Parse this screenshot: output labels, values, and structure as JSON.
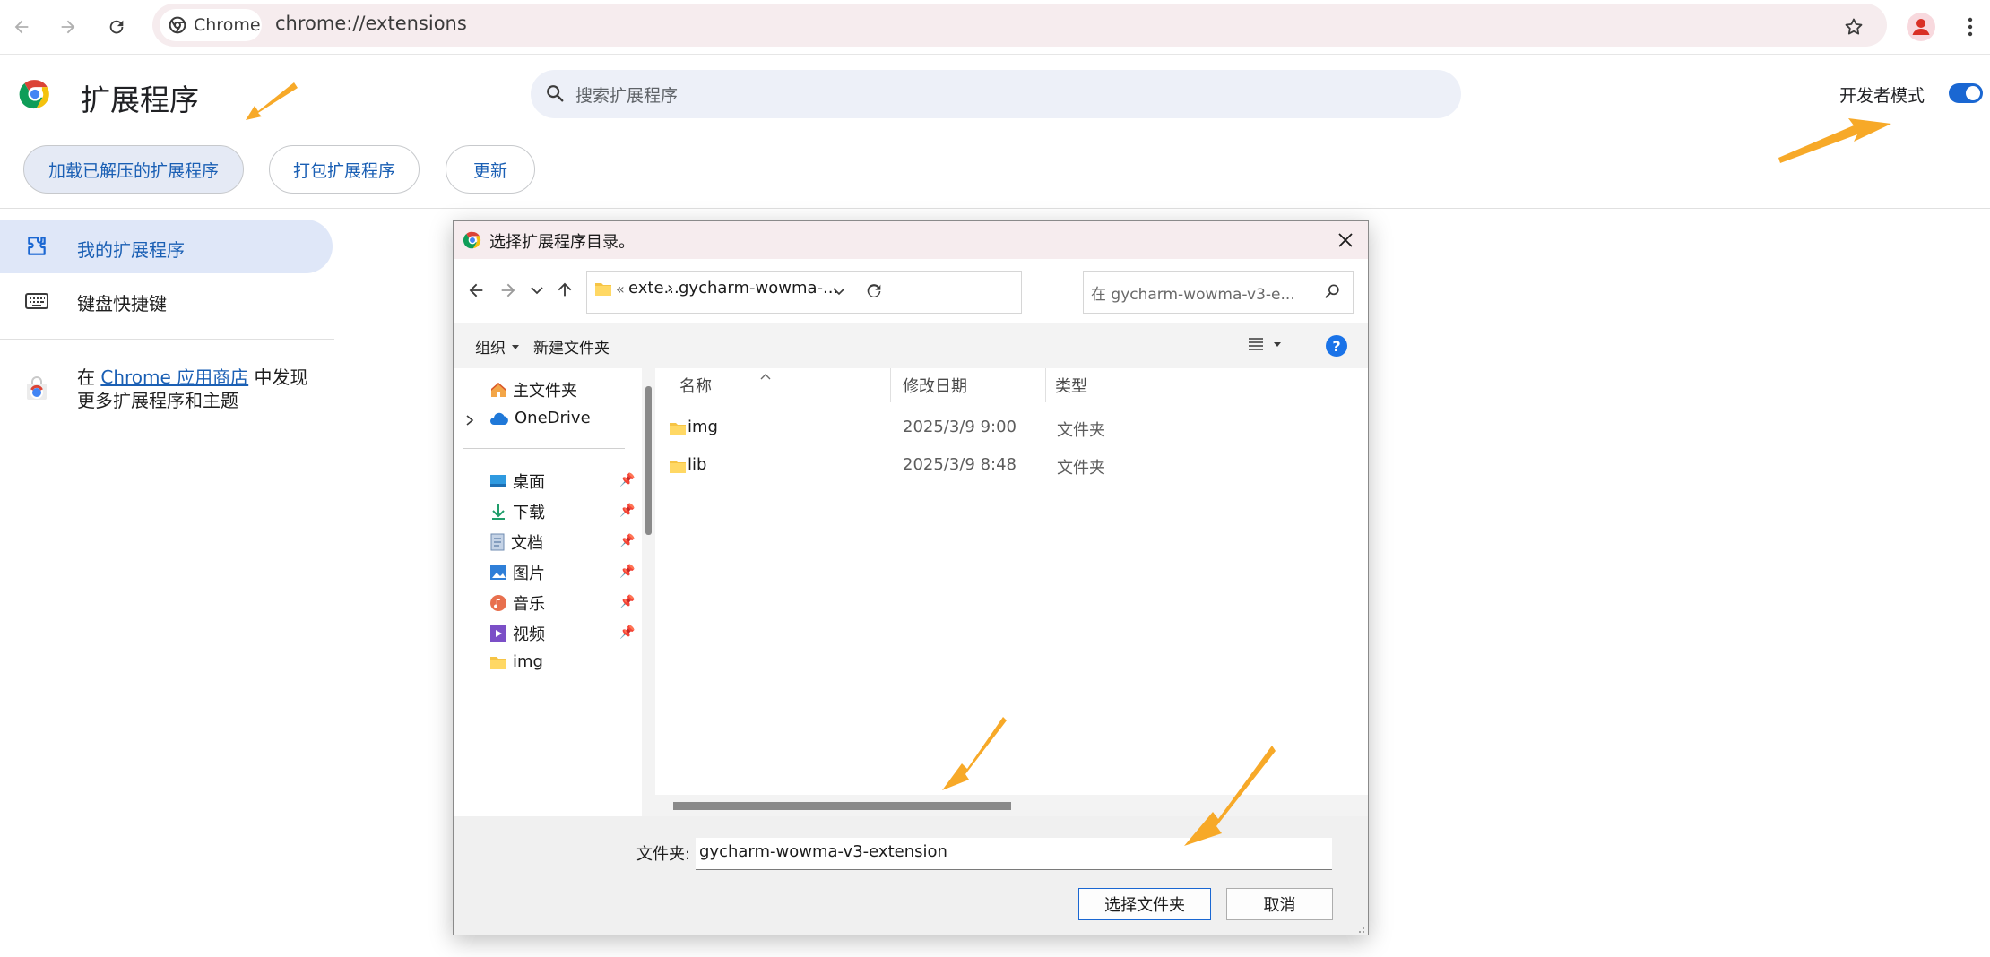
{
  "browser": {
    "chip_label": "Chrome",
    "url": "chrome://extensions"
  },
  "page": {
    "title": "扩展程序",
    "search_placeholder": "搜索扩展程序",
    "dev_mode_label": "开发者模式",
    "dev_mode_on": true,
    "actions": {
      "load_unpacked": "加载已解压的扩展程序",
      "pack": "打包扩展程序",
      "update": "更新"
    }
  },
  "sidebar": {
    "my_extensions": "我的扩展程序",
    "shortcuts": "键盘快捷键",
    "store_prefix": "在",
    "store_link": "Chrome 应用商店",
    "store_suffix": "中发现",
    "store_line2": "更多扩展程序和主题"
  },
  "dialog": {
    "title": "选择扩展程序目录。",
    "breadcrumb": {
      "overflow": "«",
      "crumb1": "exte...",
      "sep": "›",
      "crumb2": "gycharm-wowma-..."
    },
    "search_placeholder": "在 gycharm-wowma-v3-e...",
    "organize": "组织",
    "new_folder": "新建文件夹",
    "help": "?",
    "nav": {
      "home": "主文件夹",
      "onedrive": "OneDrive",
      "desktop": "桌面",
      "downloads": "下载",
      "documents": "文档",
      "pictures": "图片",
      "music": "音乐",
      "videos": "视频",
      "img": "img"
    },
    "columns": {
      "name": "名称",
      "date": "修改日期",
      "type": "类型"
    },
    "files": [
      {
        "name": "img",
        "date": "2025/3/9 9:00",
        "type": "文件夹"
      },
      {
        "name": "lib",
        "date": "2025/3/9 8:48",
        "type": "文件夹"
      }
    ],
    "folder_label": "文件夹:",
    "folder_value": "gycharm-wowma-v3-extension",
    "select_button": "选择文件夹",
    "cancel_button": "取消"
  },
  "colors": {
    "accent": "#1a67d2",
    "annotation_arrow": "#f7a928",
    "omnibox_bg": "#f6ecee",
    "nav_selected_bg": "#dfe7f8"
  }
}
